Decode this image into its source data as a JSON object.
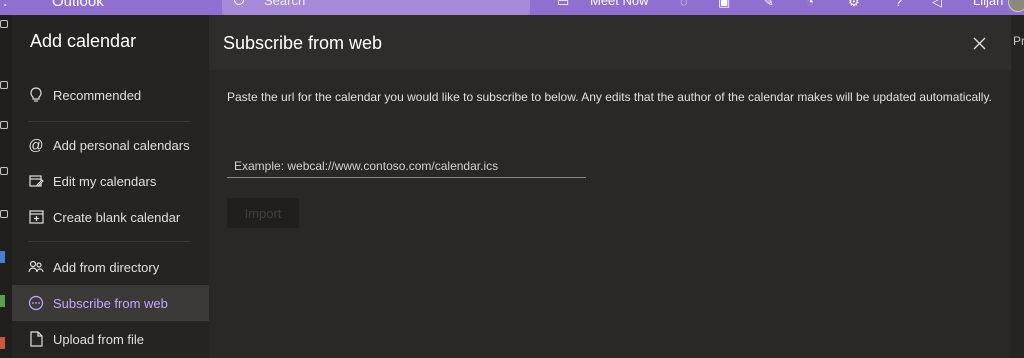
{
  "topbar": {
    "app_title": "Outlook",
    "search_label": "Search",
    "meet_now_label": "Meet Now",
    "user_name": "Liljan"
  },
  "right_edge": {
    "label": "Pr"
  },
  "sidebar": {
    "title": "Add calendar",
    "items": [
      {
        "label": "Recommended",
        "icon": "lightbulb-icon"
      },
      {
        "label": "Add personal calendars",
        "icon": "at-sign-icon"
      },
      {
        "label": "Edit my calendars",
        "icon": "edit-calendar-icon"
      },
      {
        "label": "Create blank calendar",
        "icon": "calendar-add-icon"
      },
      {
        "label": "Add from directory",
        "icon": "people-icon"
      },
      {
        "label": "Subscribe from web",
        "icon": "more-circle-icon",
        "active": true
      },
      {
        "label": "Upload from file",
        "icon": "file-icon"
      }
    ]
  },
  "panel": {
    "title": "Subscribe from web",
    "description": "Paste the url for the calendar you would like to subscribe to below. Any edits that the author of the calendar makes will be updated automatically.",
    "url_input": {
      "value": "",
      "placeholder": "Example: webcal://www.contoso.com/calendar.ics"
    },
    "import_label": "Import"
  },
  "colors": {
    "accent": "#c9a6ff",
    "topbar": "#8f6fcf"
  }
}
